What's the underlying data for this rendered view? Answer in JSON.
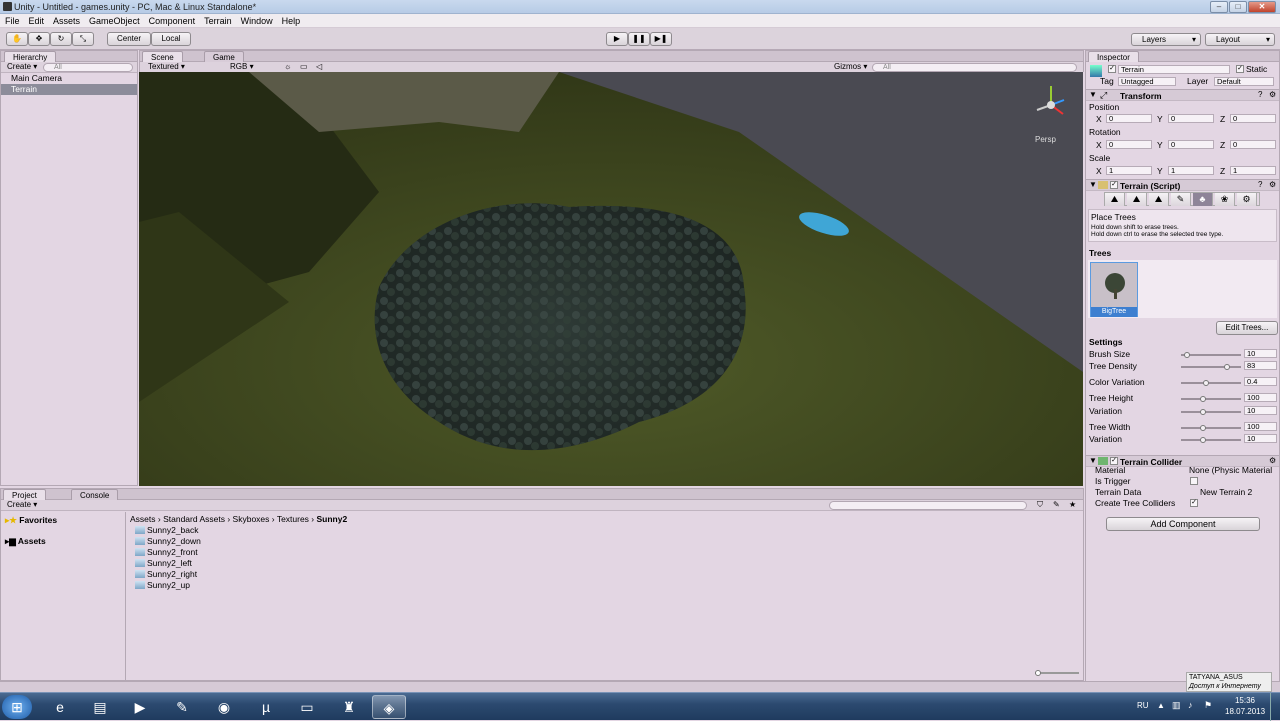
{
  "window": {
    "title": "Unity - Untitled - games.unity - PC, Mac & Linux Standalone*"
  },
  "menu": [
    "File",
    "Edit",
    "Assets",
    "GameObject",
    "Component",
    "Terrain",
    "Window",
    "Help"
  ],
  "toolbar": {
    "pivot": "Center",
    "space": "Local",
    "layers": "Layers",
    "layout": "Layout"
  },
  "hierarchy": {
    "tab": "Hierarchy",
    "create": "Create",
    "search_placeholder": "All",
    "items": [
      "Main Camera",
      "Terrain"
    ]
  },
  "scene": {
    "tab_scene": "Scene",
    "tab_game": "Game",
    "render_mode": "Textured",
    "color_mode": "RGB",
    "gizmos": "Gizmos",
    "search_placeholder": "All",
    "persp": "Persp"
  },
  "inspector": {
    "tab": "Inspector",
    "object_name": "Terrain",
    "static_label": "Static",
    "tag_label": "Tag",
    "tag_value": "Untagged",
    "layer_label": "Layer",
    "layer_value": "Default",
    "transform": {
      "title": "Transform",
      "position_label": "Position",
      "rotation_label": "Rotation",
      "scale_label": "Scale",
      "position": [
        "0",
        "0",
        "0"
      ],
      "rotation": [
        "0",
        "0",
        "0"
      ],
      "scale": [
        "1",
        "1",
        "1"
      ]
    },
    "terrain_script": {
      "title": "Terrain (Script)",
      "mode_title": "Place Trees",
      "hint1": "Hold down shift to erase trees.",
      "hint2": "Hold down ctrl to erase the selected tree type.",
      "trees_label": "Trees",
      "tree_name": "BigTree",
      "edit_trees": "Edit Trees...",
      "settings_label": "Settings",
      "settings": [
        {
          "label": "Brush Size",
          "value": "10",
          "pos": 0.05
        },
        {
          "label": "Tree Density",
          "value": "83",
          "pos": 0.8
        },
        {
          "label": "Color Variation",
          "value": "0.4",
          "pos": 0.4
        },
        {
          "label": "Tree Height",
          "value": "100",
          "pos": 0.35
        },
        {
          "label": "Variation",
          "value": "10",
          "pos": 0.35
        },
        {
          "label": "Tree Width",
          "value": "100",
          "pos": 0.35
        },
        {
          "label": "Variation",
          "value": "10",
          "pos": 0.35
        }
      ]
    },
    "collider": {
      "title": "Terrain Collider",
      "material_label": "Material",
      "material_value": "None (Physic Material",
      "trigger_label": "Is Trigger",
      "data_label": "Terrain Data",
      "data_value": "New Terrain 2",
      "create_label": "Create Tree Colliders"
    },
    "add_component": "Add Component"
  },
  "project": {
    "tab_project": "Project",
    "tab_console": "Console",
    "create": "Create",
    "favorites": "Favorites",
    "assets": "Assets",
    "breadcrumb": [
      "Assets",
      "Standard Assets",
      "Skyboxes",
      "Textures",
      "Sunny2"
    ],
    "files": [
      "Sunny2_back",
      "Sunny2_down",
      "Sunny2_front",
      "Sunny2_left",
      "Sunny2_right",
      "Sunny2_up"
    ]
  },
  "tray": {
    "user": "TATYANA_ASUS",
    "net": "Доступ к Интернету",
    "lang": "RU",
    "time": "15:36",
    "date": "18.07.2013"
  },
  "colors": {
    "selection": "#8c8c9a",
    "panel": "#e3d6e3",
    "taskbar": "#2c4a70"
  }
}
